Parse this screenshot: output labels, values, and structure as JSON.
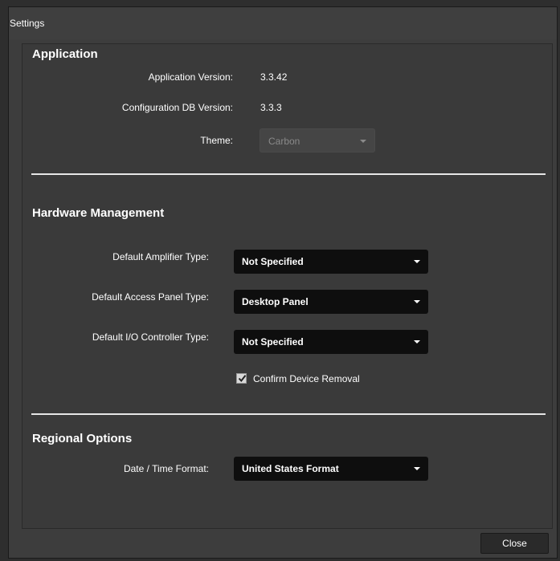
{
  "window": {
    "title": "Settings"
  },
  "application": {
    "section_title": "Application",
    "version_label": "Application Version:",
    "version_value": "3.3.42",
    "db_version_label": "Configuration DB Version:",
    "db_version_value": "3.3.3",
    "theme_label": "Theme:",
    "theme_value": "Carbon"
  },
  "hardware": {
    "section_title": "Hardware Management",
    "amplifier_label": "Default Amplifier Type:",
    "amplifier_value": "Not Specified",
    "access_panel_label": "Default Access Panel Type:",
    "access_panel_value": "Desktop Panel",
    "io_controller_label": "Default I/O Controller Type:",
    "io_controller_value": "Not Specified",
    "confirm_removal_label": "Confirm Device Removal",
    "confirm_removal_checked": true
  },
  "regional": {
    "section_title": "Regional Options",
    "datetime_label": "Date / Time Format:",
    "datetime_value": "United States Format"
  },
  "footer": {
    "close_label": "Close"
  },
  "colors": {
    "background": "#3d3d3d",
    "combo_background": "#0e0e0e",
    "divider": "#e6e6e6",
    "text": "#ffffff"
  }
}
